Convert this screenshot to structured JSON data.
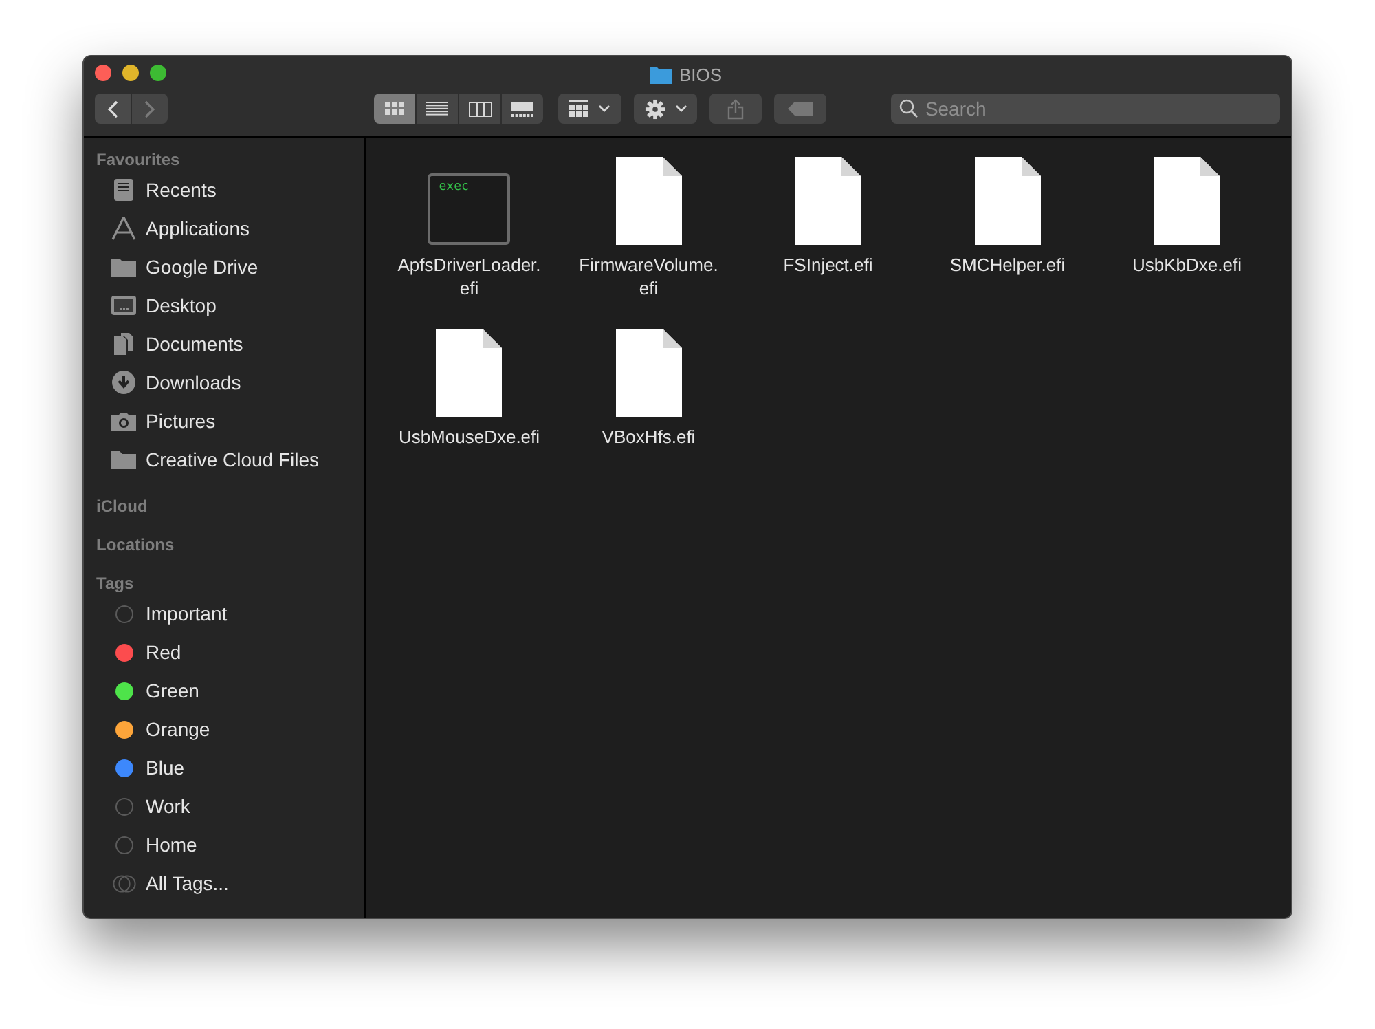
{
  "window": {
    "title": "BIOS"
  },
  "toolbar": {
    "views": [
      {
        "kind": "icons",
        "selected": true
      },
      {
        "kind": "list",
        "selected": false
      },
      {
        "kind": "columns",
        "selected": false
      },
      {
        "kind": "gallery",
        "selected": false
      }
    ],
    "search": {
      "placeholder": "Search"
    }
  },
  "sidebar": {
    "sections": [
      {
        "title": "Favourites",
        "items": [
          {
            "label": "Recents",
            "kind": "recents"
          },
          {
            "label": "Applications",
            "kind": "applications"
          },
          {
            "label": "Google Drive",
            "kind": "folder"
          },
          {
            "label": "Desktop",
            "kind": "desktop"
          },
          {
            "label": "Documents",
            "kind": "documents"
          },
          {
            "label": "Downloads",
            "kind": "downloads"
          },
          {
            "label": "Pictures",
            "kind": "pictures"
          },
          {
            "label": "Creative Cloud Files",
            "kind": "folder"
          }
        ]
      },
      {
        "title": "iCloud"
      },
      {
        "title": "Locations"
      },
      {
        "title": "Tags",
        "items": [
          {
            "label": "Important",
            "kind": "ring"
          },
          {
            "label": "Red",
            "kind": "tag",
            "color": "#fc4c4e"
          },
          {
            "label": "Green",
            "kind": "tag",
            "color": "#4ee34a"
          },
          {
            "label": "Orange",
            "kind": "tag",
            "color": "#fda53a"
          },
          {
            "label": "Blue",
            "kind": "tag",
            "color": "#3d88fc"
          },
          {
            "label": "Work",
            "kind": "ring"
          },
          {
            "label": "Home",
            "kind": "ring"
          },
          {
            "label": "All Tags...",
            "kind": "all"
          }
        ]
      }
    ]
  },
  "files": [
    {
      "name_lines": [
        "ApfsDriverLoader.",
        "efi"
      ],
      "kind": "exec",
      "icon_text": "exec"
    },
    {
      "name_lines": [
        "FirmwareVolume.",
        "efi"
      ],
      "kind": "document"
    },
    {
      "name_lines": [
        "FSInject.efi"
      ],
      "kind": "document"
    },
    {
      "name_lines": [
        "SMCHelper.efi"
      ],
      "kind": "document"
    },
    {
      "name_lines": [
        "UsbKbDxe.efi"
      ],
      "kind": "document"
    },
    {
      "name_lines": [
        "UsbMouseDxe.efi"
      ],
      "kind": "document"
    },
    {
      "name_lines": [
        "VBoxHfs.efi"
      ],
      "kind": "document"
    }
  ]
}
